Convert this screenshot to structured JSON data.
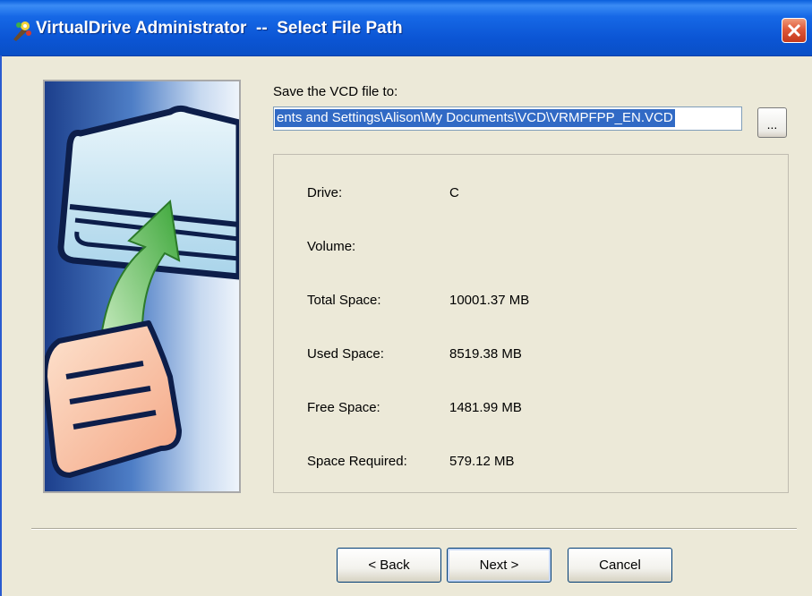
{
  "window": {
    "title": "VirtualDrive Administrator  --  Select File Path",
    "title_icon": "app-wizard-icon",
    "close_icon": "close-icon"
  },
  "form": {
    "save_label": "Save the VCD file to:",
    "path_value": "ents and Settings\\Alison\\My Documents\\VCD\\VRMPFPP_EN.VCD",
    "browse_label": "..."
  },
  "info": {
    "drive_label": "Drive:",
    "drive_value": "C",
    "volume_label": "Volume:",
    "volume_value": "",
    "total_label": "Total Space:",
    "total_value": "10001.37 MB",
    "used_label": "Used Space:",
    "used_value": "8519.38 MB",
    "free_label": "Free Space:",
    "free_value": "1481.99 MB",
    "required_label": "Space Required:",
    "required_value": "579.12 MB"
  },
  "buttons": {
    "back": "< Back",
    "next": "Next >",
    "cancel": "Cancel"
  },
  "colors": {
    "titlebar": "#0b55d4",
    "dialog_bg": "#ece9d8",
    "selection": "#316ac5",
    "close": "#e0593a"
  }
}
